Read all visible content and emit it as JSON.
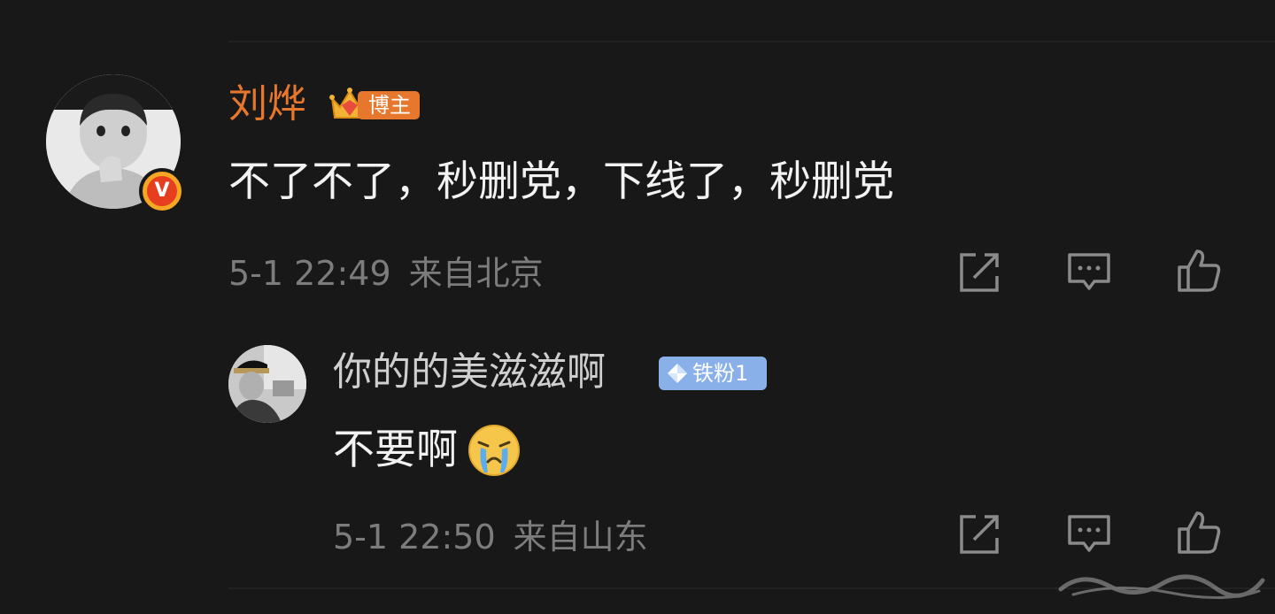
{
  "main_comment": {
    "author": "刘烨",
    "author_badge": "博主",
    "text": "不了不了，秒删党，下线了，秒删党",
    "time": "5-1 22:49",
    "location": "来自北京",
    "verified_badge": "V"
  },
  "reply": {
    "author": "你的的美滋滋啊",
    "fan_badge": "铁粉1",
    "text": "不要啊",
    "emoji": "crying-face",
    "time": "5-1 22:50",
    "location": "来自山东"
  },
  "icons": {
    "share": "share-icon",
    "comment": "comment-icon",
    "like": "like-icon"
  },
  "colors": {
    "background": "#181818",
    "author_name": "#e8772e",
    "reply_name": "#cfcfcf",
    "content_text": "#f2f2f2",
    "meta_text": "#7c7c7c",
    "fan_badge": "#8ab0ea"
  }
}
